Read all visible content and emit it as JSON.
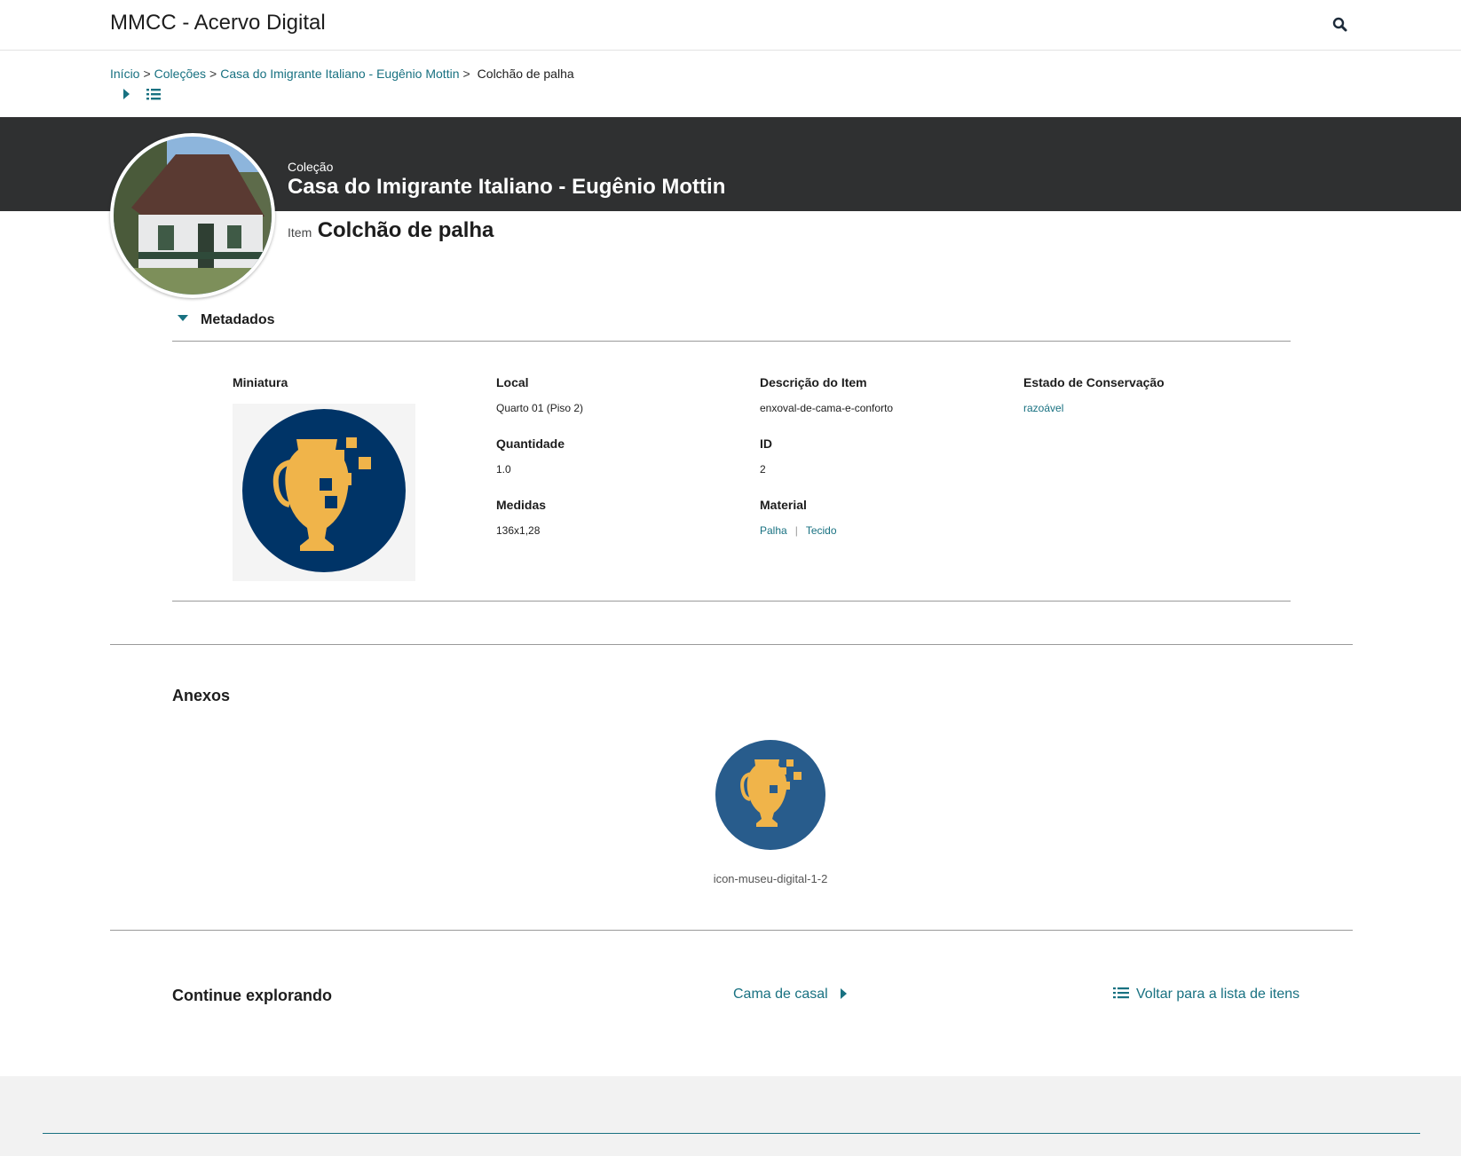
{
  "header": {
    "site_title": "MMCC - Acervo Digital",
    "search_icon": "search-icon"
  },
  "breadcrumb": {
    "items": [
      "Início",
      "Coleções",
      "Casa do Imigrante Italiano - Eugênio Mottin"
    ],
    "separator": ">",
    "current": "Colchão de palha"
  },
  "view_controls": {
    "icons": [
      "caret-right-icon",
      "list-view-icon"
    ]
  },
  "banner": {
    "collection_label": "Coleção",
    "collection_name": "Casa do Imigrante Italiano - Eugênio Mottin",
    "item_label": "Item",
    "item_name": "Colchão de palha",
    "banner_color": "#2f3031"
  },
  "metadata": {
    "toggle_label": "Metadados",
    "thumbnail_label": "Miniatura",
    "fields": {
      "local": {
        "label": "Local",
        "value": "Quarto 01 (Piso 2)"
      },
      "quantidade": {
        "label": "Quantidade",
        "value": "1.0"
      },
      "medidas": {
        "label": "Medidas",
        "value": "136x1,28"
      },
      "descricao": {
        "label": "Descrição do Item",
        "value": "enxoval-de-cama-e-conforto"
      },
      "id": {
        "label": "ID",
        "value": "2"
      },
      "material": {
        "label": "Material",
        "values": [
          "Palha",
          "Tecido"
        ],
        "separator": "|"
      },
      "estado": {
        "label": "Estado de Conservação",
        "value": "razoável"
      }
    }
  },
  "attachments": {
    "title": "Anexos",
    "items": [
      {
        "caption": "icon-museu-digital-1-2"
      }
    ]
  },
  "explore": {
    "title": "Continue explorando",
    "next_label": "Cama de casal",
    "back_label": "Voltar para a lista de itens"
  },
  "colors": {
    "link": "#187181",
    "icon_navy": "#003467",
    "icon_blue": "#285c8c",
    "icon_gold": "#f0b44a"
  }
}
